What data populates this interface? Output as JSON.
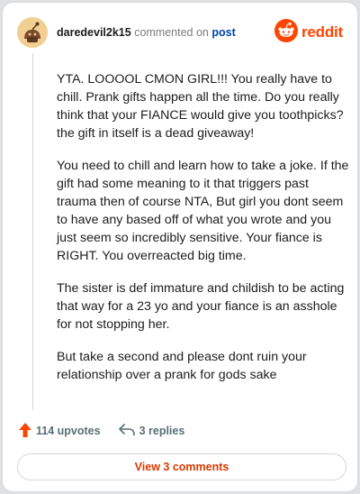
{
  "header": {
    "username": "daredevil2k15",
    "action_text": "commented on",
    "post_link": "post",
    "brand": "reddit",
    "avatar_icon": "snoo-avatar-icon",
    "brand_icon": "reddit-alien-icon"
  },
  "comment": {
    "paragraphs": [
      "YTA. LOOOOL CMON GIRL!!! You really have to chill. Prank gifts happen all the time. Do you really think that your FIANCE would give you toothpicks?the gift in itself is a dead giveaway!",
      "You need to chill and learn how to take a joke. If the gift had some meaning to it that triggers past trauma then of course NTA, But girl you dont seem to have any based off of what you wrote and you just seem so incredibly sensitive. Your fiance is RIGHT. You overreacted big time.",
      "The sister is def immature and childish to be acting that way for a 23 yo and your fiance is an asshole for not stopping her.",
      "But take a second and please dont ruin your relationship over a prank for gods sake"
    ]
  },
  "actions": {
    "upvotes_label": "114 upvotes",
    "replies_label": "3 replies",
    "upvote_icon": "upvote-arrow-icon",
    "reply_icon": "reply-arrow-icon"
  },
  "footer": {
    "view_comments_label": "View 3 comments"
  },
  "colors": {
    "brand": "#ff4500",
    "link": "#0045ac",
    "muted": "#576f76",
    "view_comments": "#d93a00"
  }
}
